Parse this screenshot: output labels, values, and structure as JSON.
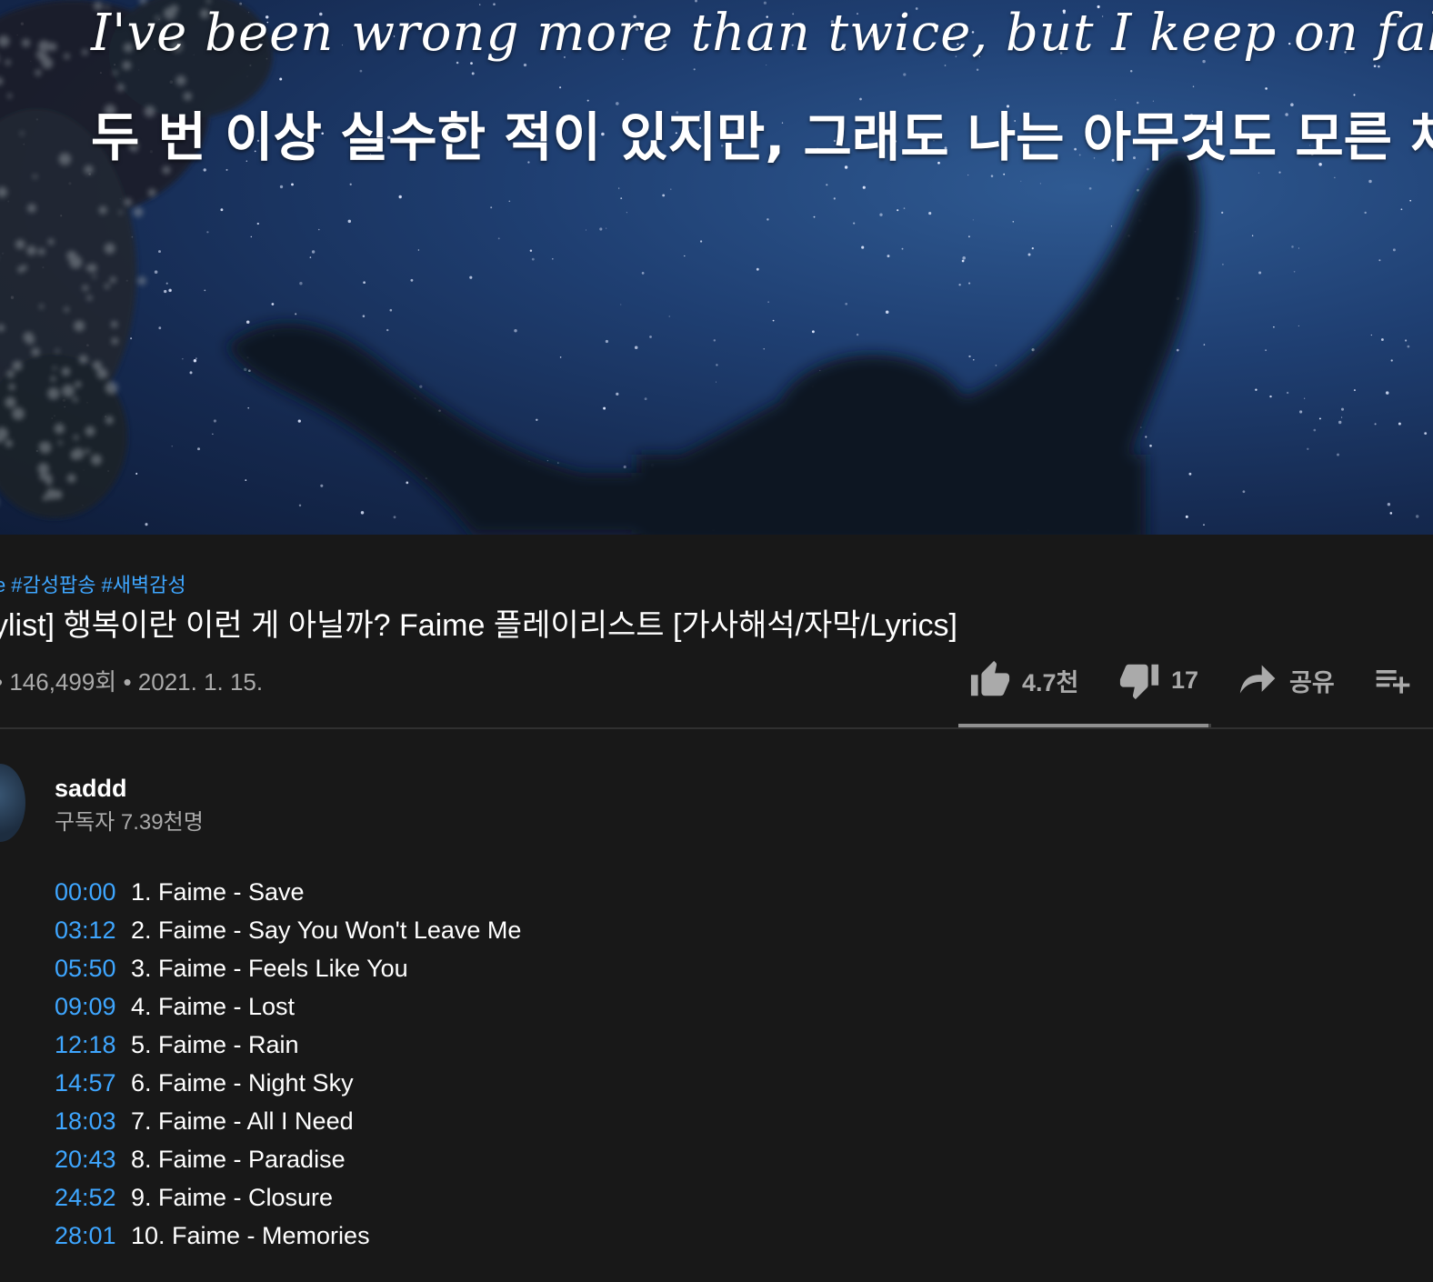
{
  "video": {
    "lyric_en": "I've been wrong more than twice, but I keep on falling",
    "lyric_ko": "두 번 이상 실수한 적이 있지만, 그래도 나는 아무것도 모른 채"
  },
  "info": {
    "hashtags": [
      "e",
      "#감성팝송",
      "#새벽감성"
    ],
    "title": "ylist] 행복이란 이런 게 아닐까? Faime 플레이리스트 [가사해석/자막/Lyrics]",
    "views": "146,499회 • 2021. 1. 15."
  },
  "actions": {
    "like_count": "4.7천",
    "dislike_count": "17",
    "share_label": "공유"
  },
  "sentiment": {
    "like_ratio": 0.99
  },
  "channel": {
    "name": "saddd",
    "subscribers": "구독자 7.39천명"
  },
  "tracks": [
    {
      "time": "00:00",
      "name": "1. Faime - Save"
    },
    {
      "time": "03:12",
      "name": "2. Faime - Say You Won't Leave Me"
    },
    {
      "time": "05:50",
      "name": "3. Faime - Feels Like You"
    },
    {
      "time": "09:09",
      "name": "4. Faime - Lost"
    },
    {
      "time": "12:18",
      "name": "5. Faime - Rain"
    },
    {
      "time": "14:57",
      "name": "6. Faime - Night Sky"
    },
    {
      "time": "18:03",
      "name": "7. Faime - All I Need"
    },
    {
      "time": "20:43",
      "name": "8. Faime - Paradise"
    },
    {
      "time": "24:52",
      "name": "9. Faime - Closure"
    },
    {
      "time": "28:01",
      "name": "10. Faime - Memories"
    }
  ],
  "colors": {
    "background": "#181818",
    "link_blue": "#3ea6ff",
    "muted_text": "#aaaaaa",
    "sky_blue": "#1f3f72"
  },
  "icons": [
    "like-icon",
    "dislike-icon",
    "share-icon",
    "add-to-playlist-icon"
  ]
}
